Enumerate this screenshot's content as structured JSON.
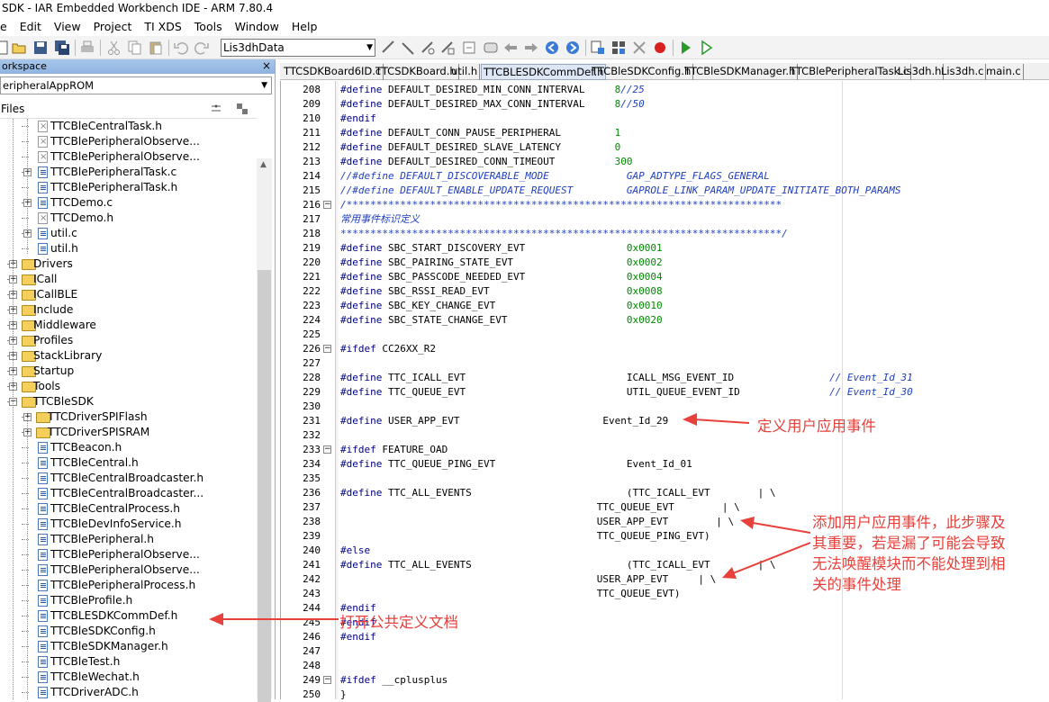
{
  "window": {
    "title": "SDK - IAR Embedded Workbench IDE - ARM 7.80.4"
  },
  "menu": [
    "e",
    "Edit",
    "View",
    "Project",
    "TI XDS",
    "Tools",
    "Window",
    "Help"
  ],
  "toolbar": {
    "search_combo": "Lis3dhData"
  },
  "workspace": {
    "header": "orkspace",
    "close": "×",
    "config": "eripheralAppROM",
    "files_label": "Files",
    "tree": [
      {
        "indent": 2,
        "type": "file-x",
        "label": "TTCBleCentralTask.h"
      },
      {
        "indent": 2,
        "type": "file-x",
        "label": "TTCBlePeripheralObserve..."
      },
      {
        "indent": 2,
        "type": "file-x",
        "label": "TTCBlePeripheralObserve..."
      },
      {
        "indent": 2,
        "type": "file",
        "label": "TTCBlePeripheralTask.c",
        "exp": true
      },
      {
        "indent": 2,
        "type": "file",
        "label": "TTCBlePeripheralTask.h"
      },
      {
        "indent": 2,
        "type": "file",
        "label": "TTCDemo.c",
        "exp": true
      },
      {
        "indent": 2,
        "type": "file-x",
        "label": "TTCDemo.h"
      },
      {
        "indent": 2,
        "type": "file",
        "label": "util.c",
        "exp": true
      },
      {
        "indent": 2,
        "type": "file",
        "label": "util.h"
      },
      {
        "indent": 1,
        "type": "folder",
        "label": "Drivers",
        "exp": true
      },
      {
        "indent": 1,
        "type": "folder",
        "label": "ICall",
        "exp": true
      },
      {
        "indent": 1,
        "type": "folder",
        "label": "ICallBLE",
        "exp": true
      },
      {
        "indent": 1,
        "type": "folder",
        "label": "Include",
        "exp": true
      },
      {
        "indent": 1,
        "type": "folder",
        "label": "Middleware",
        "exp": true
      },
      {
        "indent": 1,
        "type": "folder",
        "label": "Profiles",
        "exp": true
      },
      {
        "indent": 1,
        "type": "folder",
        "label": "StackLibrary",
        "exp": true
      },
      {
        "indent": 1,
        "type": "folder",
        "label": "Startup",
        "exp": true
      },
      {
        "indent": 1,
        "type": "folder",
        "label": "Tools",
        "exp": true
      },
      {
        "indent": 1,
        "type": "folder",
        "label": "TTCBleSDK",
        "exp": true,
        "open": true
      },
      {
        "indent": 2,
        "type": "folder",
        "label": "TTCDriverSPIFlash",
        "exp": true
      },
      {
        "indent": 2,
        "type": "folder",
        "label": "TTCDriverSPISRAM",
        "exp": true
      },
      {
        "indent": 2,
        "type": "file",
        "label": "TTCBeacon.h"
      },
      {
        "indent": 2,
        "type": "file",
        "label": "TTCBleCentral.h"
      },
      {
        "indent": 2,
        "type": "file",
        "label": "TTCBleCentralBroadcaster.h"
      },
      {
        "indent": 2,
        "type": "file",
        "label": "TTCBleCentralBroadcaster..."
      },
      {
        "indent": 2,
        "type": "file",
        "label": "TTCBleCentralProcess.h"
      },
      {
        "indent": 2,
        "type": "file",
        "label": "TTCBleDevInfoService.h"
      },
      {
        "indent": 2,
        "type": "file",
        "label": "TTCBlePeripheral.h"
      },
      {
        "indent": 2,
        "type": "file",
        "label": "TTCBlePeripheralObserve..."
      },
      {
        "indent": 2,
        "type": "file",
        "label": "TTCBlePeripheralObserve..."
      },
      {
        "indent": 2,
        "type": "file",
        "label": "TTCBlePeripheralProcess.h"
      },
      {
        "indent": 2,
        "type": "file",
        "label": "TTCBleProfile.h"
      },
      {
        "indent": 2,
        "type": "file",
        "label": "TTCBLESDKCommDef.h"
      },
      {
        "indent": 2,
        "type": "file",
        "label": "TTCBleSDKConfig.h"
      },
      {
        "indent": 2,
        "type": "file",
        "label": "TTCBleSDKManager.h"
      },
      {
        "indent": 2,
        "type": "file",
        "label": "TTCBleTest.h"
      },
      {
        "indent": 2,
        "type": "file",
        "label": "TTCBleWechat.h"
      },
      {
        "indent": 2,
        "type": "file",
        "label": "TTCDriverADC.h"
      }
    ]
  },
  "tabs": [
    {
      "label": "TTCSDKBoard6ID.c",
      "active": false
    },
    {
      "label": "TTCSDKBoard.h",
      "active": false
    },
    {
      "label": "util.h",
      "active": false
    },
    {
      "label": "TTCBLESDKCommDef.h",
      "active": true
    },
    {
      "label": "TTCBleSDKConfig.h",
      "active": false
    },
    {
      "label": "TTCBleSDKManager.h",
      "active": false
    },
    {
      "label": "TTCBlePeripheralTask.c",
      "active": false
    },
    {
      "label": "Lis3dh.h",
      "active": false
    },
    {
      "label": "Lis3dh.c",
      "active": false
    },
    {
      "label": "main.c",
      "active": false
    }
  ],
  "code": [
    {
      "n": "208",
      "t": [
        [
          "kw",
          "#define "
        ],
        [
          "",
          "DEFAULT_DESIRED_MIN_CONN_INTERVAL     "
        ],
        [
          "num",
          "8"
        ],
        [
          "cm",
          "//25"
        ]
      ]
    },
    {
      "n": "209",
      "t": [
        [
          "kw",
          "#define "
        ],
        [
          "",
          "DEFAULT_DESIRED_MAX_CONN_INTERVAL     "
        ],
        [
          "num",
          "8"
        ],
        [
          "cm",
          "//50"
        ]
      ]
    },
    {
      "n": "210",
      "t": [
        [
          "kw",
          "#endif"
        ]
      ]
    },
    {
      "n": "211",
      "t": [
        [
          "kw",
          "#define "
        ],
        [
          "",
          "DEFAULT_CONN_PAUSE_PERIPHERAL         "
        ],
        [
          "num",
          "1"
        ]
      ]
    },
    {
      "n": "212",
      "t": [
        [
          "kw",
          "#define "
        ],
        [
          "",
          "DEFAULT_DESIRED_SLAVE_LATENCY         "
        ],
        [
          "num",
          "0"
        ]
      ]
    },
    {
      "n": "213",
      "t": [
        [
          "kw",
          "#define "
        ],
        [
          "",
          "DEFAULT_DESIRED_CONN_TIMEOUT          "
        ],
        [
          "num",
          "300"
        ]
      ]
    },
    {
      "n": "214",
      "t": [
        [
          "cm",
          "//#define DEFAULT_DISCOVERABLE_MODE             GAP_ADTYPE_FLAGS_GENERAL"
        ]
      ]
    },
    {
      "n": "215",
      "t": [
        [
          "cm",
          "//#define DEFAULT_ENABLE_UPDATE_REQUEST         GAPROLE_LINK_PARAM_UPDATE_INITIATE_BOTH_PARAMS"
        ]
      ]
    },
    {
      "n": "216",
      "fold": true,
      "t": [
        [
          "cm",
          "/*************************************************************************"
        ]
      ]
    },
    {
      "n": "217",
      "t": [
        [
          "cm",
          "常用事件标识定义"
        ]
      ]
    },
    {
      "n": "218",
      "t": [
        [
          "cm",
          "**************************************************************************/"
        ]
      ]
    },
    {
      "n": "219",
      "t": [
        [
          "kw",
          "#define "
        ],
        [
          "",
          "SBC_START_DISCOVERY_EVT                 "
        ],
        [
          "num",
          "0x0001"
        ]
      ]
    },
    {
      "n": "220",
      "t": [
        [
          "kw",
          "#define "
        ],
        [
          "",
          "SBC_PAIRING_STATE_EVT                   "
        ],
        [
          "num",
          "0x0002"
        ]
      ]
    },
    {
      "n": "221",
      "t": [
        [
          "kw",
          "#define "
        ],
        [
          "",
          "SBC_PASSCODE_NEEDED_EVT                 "
        ],
        [
          "num",
          "0x0004"
        ]
      ]
    },
    {
      "n": "222",
      "t": [
        [
          "kw",
          "#define "
        ],
        [
          "",
          "SBC_RSSI_READ_EVT                       "
        ],
        [
          "num",
          "0x0008"
        ]
      ]
    },
    {
      "n": "223",
      "t": [
        [
          "kw",
          "#define "
        ],
        [
          "",
          "SBC_KEY_CHANGE_EVT                      "
        ],
        [
          "num",
          "0x0010"
        ]
      ]
    },
    {
      "n": "224",
      "t": [
        [
          "kw",
          "#define "
        ],
        [
          "",
          "SBC_STATE_CHANGE_EVT                    "
        ],
        [
          "num",
          "0x0020"
        ]
      ]
    },
    {
      "n": "225",
      "t": []
    },
    {
      "n": "226",
      "fold": true,
      "t": [
        [
          "kw",
          "#ifdef "
        ],
        [
          "",
          "CC26XX_R2"
        ]
      ]
    },
    {
      "n": "227",
      "t": []
    },
    {
      "n": "228",
      "t": [
        [
          "kw",
          "#define "
        ],
        [
          "",
          "TTC_ICALL_EVT                           ICALL_MSG_EVENT_ID                "
        ],
        [
          "cm",
          "// Event_Id_31"
        ]
      ]
    },
    {
      "n": "229",
      "t": [
        [
          "kw",
          "#define "
        ],
        [
          "",
          "TTC_QUEUE_EVT                           UTIL_QUEUE_EVENT_ID               "
        ],
        [
          "cm",
          "// Event_Id_30"
        ]
      ]
    },
    {
      "n": "230",
      "t": []
    },
    {
      "n": "231",
      "t": [
        [
          "kw",
          "#define "
        ],
        [
          "",
          "USER_APP_EVT                        Event_Id_29"
        ]
      ]
    },
    {
      "n": "232",
      "t": []
    },
    {
      "n": "233",
      "fold": true,
      "t": [
        [
          "kw",
          "#ifdef "
        ],
        [
          "",
          "FEATURE_OAD"
        ]
      ]
    },
    {
      "n": "234",
      "t": [
        [
          "kw",
          "#define "
        ],
        [
          "",
          "TTC_QUEUE_PING_EVT                      Event_Id_01"
        ]
      ]
    },
    {
      "n": "235",
      "t": []
    },
    {
      "n": "236",
      "t": [
        [
          "kw",
          "#define "
        ],
        [
          "",
          "TTC_ALL_EVENTS                          (TTC_ICALL_EVT        | \\"
        ]
      ]
    },
    {
      "n": "237",
      "t": [
        [
          "",
          "                                           TTC_QUEUE_EVT        | \\"
        ]
      ]
    },
    {
      "n": "238",
      "t": [
        [
          "",
          "                                           USER_APP_EVT        | \\"
        ]
      ]
    },
    {
      "n": "239",
      "t": [
        [
          "",
          "                                           TTC_QUEUE_PING_EVT)"
        ]
      ]
    },
    {
      "n": "240",
      "t": [
        [
          "kw",
          "#else"
        ]
      ]
    },
    {
      "n": "241",
      "t": [
        [
          "kw",
          "#define "
        ],
        [
          "",
          "TTC_ALL_EVENTS                          (TTC_ICALL_EVT        | \\"
        ]
      ]
    },
    {
      "n": "242",
      "t": [
        [
          "",
          "                                           USER_APP_EVT     | \\"
        ]
      ]
    },
    {
      "n": "243",
      "t": [
        [
          "",
          "                                           TTC_QUEUE_EVT)"
        ]
      ]
    },
    {
      "n": "244",
      "t": [
        [
          "kw",
          "#endif"
        ]
      ]
    },
    {
      "n": "245",
      "t": [
        [
          "kw",
          "#endif"
        ]
      ]
    },
    {
      "n": "246",
      "t": [
        [
          "kw",
          "#endif"
        ]
      ]
    },
    {
      "n": "247",
      "t": []
    },
    {
      "n": "248",
      "t": []
    },
    {
      "n": "249",
      "fold": true,
      "t": [
        [
          "kw",
          "#ifdef "
        ],
        [
          "",
          "__cplusplus"
        ]
      ]
    },
    {
      "n": "250",
      "t": [
        [
          "",
          "}"
        ]
      ]
    }
  ],
  "annotations": {
    "a1": "定义用户应用事件",
    "a2_lines": [
      "添加用户应用事件，此步骤及",
      "其重要，若是漏了可能会导致",
      "无法唤醒模块而不能处理到相",
      "关的事件处理"
    ],
    "a3": "打开公共定义文档"
  },
  "colors": {
    "annotation": "#e8403a",
    "keyword": "#00008b",
    "number": "#008a00",
    "comment": "#1f3fbf"
  }
}
